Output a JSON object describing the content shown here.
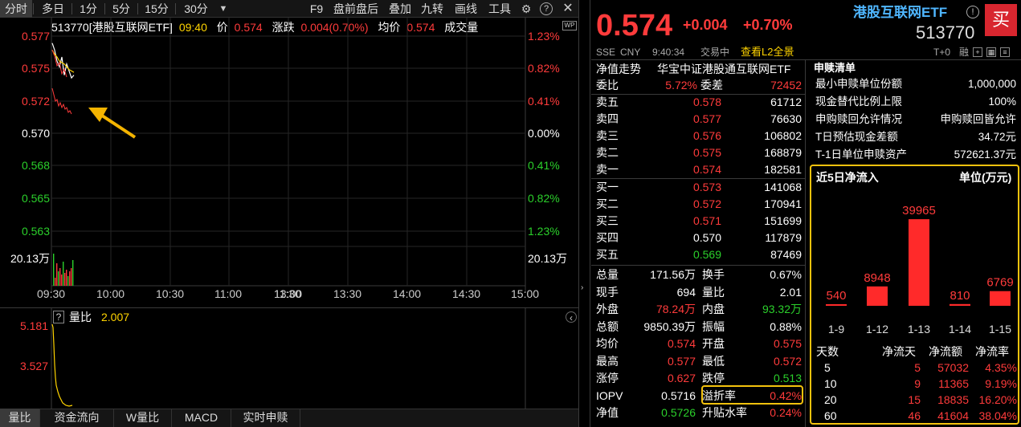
{
  "tabs": {
    "fenshi": "分时",
    "duori": "多日",
    "m1": "1分",
    "m5": "5分",
    "m15": "15分",
    "m30": "30分",
    "f9": "F9",
    "panqian": "盘前盘后",
    "diejia": "叠加",
    "jiuzhuan": "九转",
    "huaxian": "画线",
    "gongju": "工具"
  },
  "chart": {
    "header_code": "513770[港股互联网ETF]",
    "header_time": "09:40",
    "header_price_label": "价",
    "header_price": "0.574",
    "header_change_label": "涨跌",
    "header_change": "0.004(0.70%)",
    "header_avg_label": "均价",
    "header_avg": "0.574",
    "header_vol_label": "成交量",
    "wp_badge": "WP",
    "yticks_left": [
      "0.577",
      "0.575",
      "0.572",
      "0.570",
      "0.568",
      "0.565",
      "0.563"
    ],
    "yticks_right": [
      "1.23%",
      "0.82%",
      "0.41%",
      "0.00%",
      "0.41%",
      "0.82%",
      "1.23%"
    ],
    "vol_left": "20.13万",
    "vol_right": "20.13万",
    "xticks": [
      "09:30",
      "10:00",
      "10:30",
      "11:00",
      "11:30",
      "13:00",
      "13:30",
      "14:00",
      "14:30",
      "15:00"
    ]
  },
  "chart_data": {
    "type": "line",
    "series": [
      {
        "name": "价",
        "color": "#ffffff",
        "values": [
          0.5765,
          0.576,
          0.5752,
          0.5748,
          0.5755,
          0.5742,
          0.575,
          0.5745,
          0.574,
          0.5742
        ]
      },
      {
        "name": "均价",
        "color": "#ffd400",
        "values": [
          0.576,
          0.5757,
          0.5755,
          0.5752,
          0.5751,
          0.575,
          0.5748,
          0.5746,
          0.5745,
          0.5744
        ]
      }
    ],
    "ylim": [
      0.5625,
      0.5775
    ],
    "x": [
      "09:30",
      "09:31",
      "09:32",
      "09:33",
      "09:34",
      "09:35",
      "09:36",
      "09:37",
      "09:38",
      "09:39"
    ]
  },
  "lower": {
    "q": "?",
    "liangbi_label": "量比",
    "liangbi_value": "2.007",
    "ticks": [
      "5.181",
      "3.527"
    ]
  },
  "bottom_tabs": [
    "量比",
    "资金流向",
    "W量比",
    "MACD",
    "实时申赎"
  ],
  "quote": {
    "price": "0.574",
    "change": "+0.004",
    "pct": "+0.70%",
    "name": "港股互联网ETF",
    "code": "513770",
    "buy_btn": "买",
    "exchange": "SSE",
    "currency": "CNY",
    "time": "9:40:34",
    "status": "交易中",
    "l2": "查看L2全景",
    "t0": "T+0",
    "rong": "融"
  },
  "nav_row": {
    "label": "净值走势",
    "value": "华宝中证港股通互联网ETF"
  },
  "weibi": {
    "label1": "委比",
    "v1": "5.72%",
    "label2": "委差",
    "v2": "72452"
  },
  "asks": [
    {
      "label": "卖五",
      "price": "0.578",
      "vol": "61712"
    },
    {
      "label": "卖四",
      "price": "0.577",
      "vol": "76630"
    },
    {
      "label": "卖三",
      "price": "0.576",
      "vol": "106802"
    },
    {
      "label": "卖二",
      "price": "0.575",
      "vol": "168879"
    },
    {
      "label": "卖一",
      "price": "0.574",
      "vol": "182581"
    }
  ],
  "bids": [
    {
      "label": "买一",
      "price": "0.573",
      "vol": "141068"
    },
    {
      "label": "买二",
      "price": "0.572",
      "vol": "170941"
    },
    {
      "label": "买三",
      "price": "0.571",
      "vol": "151699"
    },
    {
      "label": "买四",
      "price": "0.570",
      "vol": "117879"
    },
    {
      "label": "买五",
      "price": "0.569",
      "vol": "87469"
    }
  ],
  "stats": [
    {
      "l1": "总量",
      "v1": "171.56万",
      "c1": "white",
      "l2": "换手",
      "v2": "0.67%",
      "c2": "white"
    },
    {
      "l1": "现手",
      "v1": "694",
      "c1": "white",
      "l2": "量比",
      "v2": "2.01",
      "c2": "white"
    },
    {
      "l1": "外盘",
      "v1": "78.24万",
      "c1": "red",
      "l2": "内盘",
      "v2": "93.32万",
      "c2": "green"
    },
    {
      "l1": "总额",
      "v1": "9850.39万",
      "c1": "white",
      "l2": "振幅",
      "v2": "0.88%",
      "c2": "white"
    },
    {
      "l1": "均价",
      "v1": "0.574",
      "c1": "red",
      "l2": "开盘",
      "v2": "0.575",
      "c2": "red"
    },
    {
      "l1": "最高",
      "v1": "0.577",
      "c1": "red",
      "l2": "最低",
      "v2": "0.572",
      "c2": "red"
    },
    {
      "l1": "涨停",
      "v1": "0.627",
      "c1": "red",
      "l2": "跌停",
      "v2": "0.513",
      "c2": "green"
    },
    {
      "l1": "IOPV",
      "v1": "0.5716",
      "c1": "white",
      "l2": "溢折率",
      "v2": "0.42%",
      "c2": "red"
    },
    {
      "l1": "净值",
      "v1": "0.5726",
      "c1": "green",
      "l2": "升贴水率",
      "v2": "0.24%",
      "c2": "red"
    }
  ],
  "creation": {
    "title": "申赎清单",
    "rows": [
      {
        "label": "最小申赎单位份额",
        "value": "1,000,000"
      },
      {
        "label": "现金替代比例上限",
        "value": "100%"
      },
      {
        "label": "申购赎回允许情况",
        "value": "申购赎回皆允许"
      },
      {
        "label": "T日预估现金差额",
        "value": "34.72元"
      },
      {
        "label": "T-1日单位申赎资产",
        "value": "572621.37元"
      }
    ]
  },
  "inflow": {
    "title": "近5日净流入",
    "unit": "单位(万元)",
    "bars": [
      {
        "date": "1-9",
        "value": 540
      },
      {
        "date": "1-12",
        "value": 8948
      },
      {
        "date": "1-13",
        "value": 39965
      },
      {
        "date": "1-14",
        "value": 810
      },
      {
        "date": "1-15",
        "value": 6769
      }
    ],
    "table_headers": [
      "天数",
      "净流天",
      "净流额",
      "净流率"
    ],
    "table_rows": [
      {
        "days": "5",
        "d": "5",
        "amt": "57032",
        "rate": "4.35%"
      },
      {
        "days": "10",
        "d": "9",
        "amt": "11365",
        "rate": "9.19%"
      },
      {
        "days": "20",
        "d": "15",
        "amt": "18835",
        "rate": "16.20%"
      },
      {
        "days": "60",
        "d": "46",
        "amt": "41604",
        "rate": "38.04%"
      }
    ]
  },
  "colors": {
    "up": "#ff3b3b",
    "down": "#2bd02b",
    "accent": "#f4c20d",
    "bg": "#000000"
  }
}
